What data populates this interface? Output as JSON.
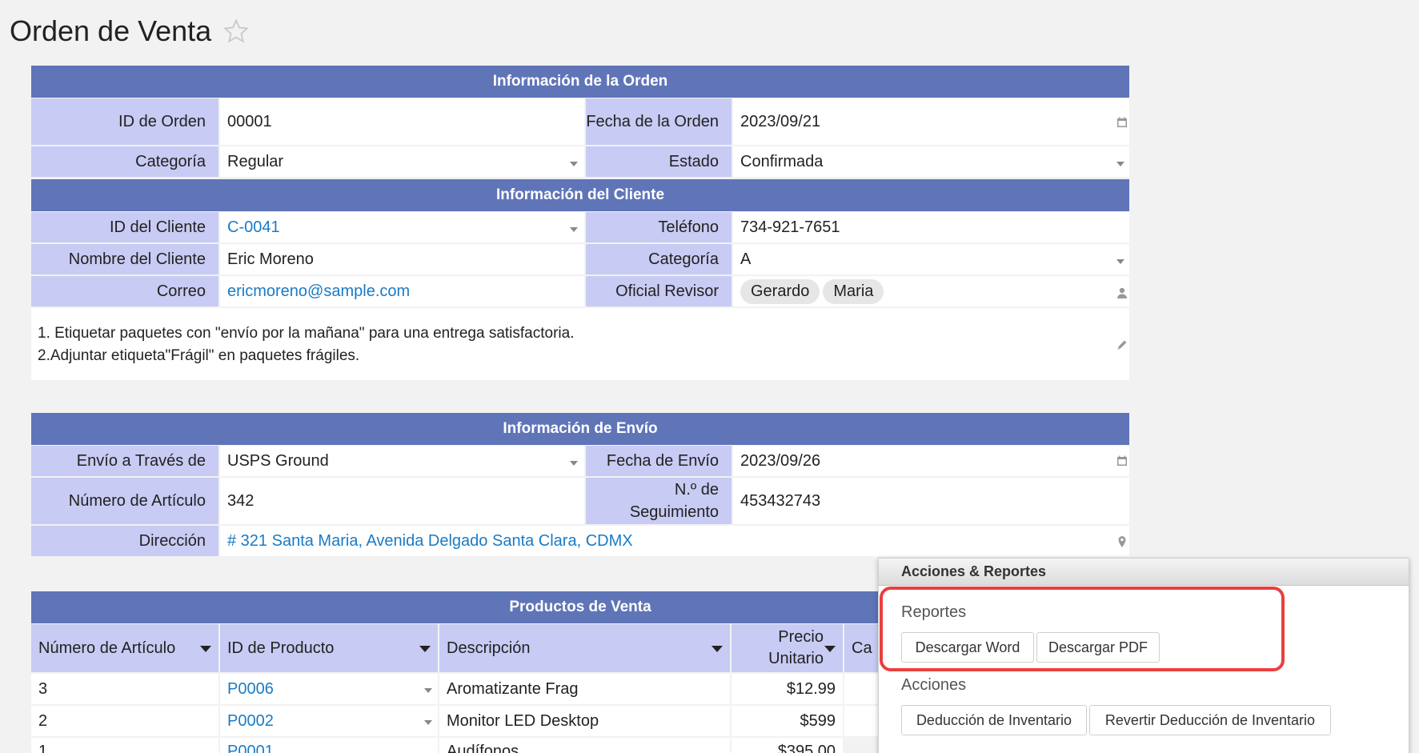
{
  "page": {
    "title": "Orden de Venta"
  },
  "order_info": {
    "header": "Información de la Orden",
    "order_id_label": "ID de Orden",
    "order_id": "00001",
    "order_date_label": "Fecha de la Orden",
    "order_date": "2023/09/21",
    "category_label": "Categoría",
    "category": "Regular",
    "status_label": "Estado",
    "status": "Confirmada"
  },
  "client_info": {
    "header": "Información del Cliente",
    "client_id_label": "ID del Cliente",
    "client_id": "C-0041",
    "phone_label": "Teléfono",
    "phone": "734-921-7651",
    "client_name_label": "Nombre del Cliente",
    "client_name": "Eric Moreno",
    "category_label": "Categoría",
    "category": "A",
    "email_label": "Correo",
    "email": "ericmoreno@sample.com",
    "reviewer_label": "Oficial Revisor",
    "reviewers": [
      "Gerardo",
      "Maria"
    ]
  },
  "notes": {
    "line1": "1. Etiquetar paquetes con \"envío por la mañana\" para una entrega satisfactoria.",
    "line2": "2.Adjuntar etiqueta\"Frágil\" en paquetes frágiles."
  },
  "shipping_info": {
    "header": "Información de Envío",
    "ship_via_label": "Envío a Través de",
    "ship_via": "USPS Ground",
    "ship_date_label": "Fecha de Envío",
    "ship_date": "2023/09/26",
    "item_number_label": "Número de Artículo",
    "item_number": "342",
    "tracking_label": "N.º de Seguimiento",
    "tracking": "453432743",
    "address_label": "Dirección",
    "address": "# 321 Santa Maria, Avenida Delgado Santa Clara, CDMX"
  },
  "products": {
    "header": "Productos de Venta",
    "columns": [
      "Número de Artículo",
      "ID de Producto",
      "Descripción",
      "Precio Unitario",
      "Ca"
    ],
    "rows": [
      {
        "num": "3",
        "product_id": "P0006",
        "description": "Aromatizante Frag",
        "price": "$12.99"
      },
      {
        "num": "2",
        "product_id": "P0002",
        "description": "Monitor LED Desktop",
        "price": "$599"
      },
      {
        "num": "1",
        "product_id": "P0001",
        "description": "Audífonos",
        "price": "$395.00"
      }
    ]
  },
  "actions_panel": {
    "title": "Acciones & Reportes",
    "reports_title": "Reportes",
    "download_word": "Descargar Word",
    "download_pdf": "Descargar PDF",
    "actions_title": "Acciones",
    "inventory_deduction": "Deducción de Inventario",
    "revert_deduction": "Revertir Deducción de Inventario"
  },
  "colors": {
    "header_bg": "#5f75b8",
    "label_bg": "#c8cbf3",
    "link": "#1a7bc4",
    "highlight": "#e8403f"
  },
  "icons": [
    "star-icon",
    "calendar-icon",
    "chevron-down-icon",
    "user-icon",
    "pencil-icon",
    "location-pin-icon"
  ]
}
